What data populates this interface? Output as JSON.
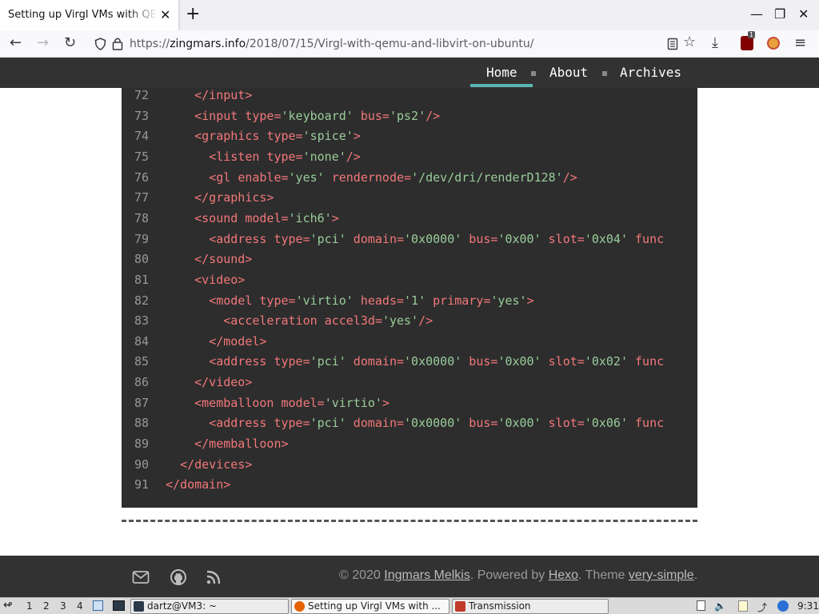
{
  "browser": {
    "tab_title": "Setting up Virgl VMs with QEMU",
    "tab_close": "✕",
    "new_tab": "+",
    "url_scheme": "https://",
    "url_host": "zingmars.info",
    "url_path": "/2018/07/15/Virgl-with-qemu-and-libvirt-on-ubuntu/",
    "extension_badge": "1"
  },
  "site": {
    "menu": [
      "Home",
      "About",
      "Archives"
    ]
  },
  "code": {
    "lines": [
      {
        "n": "72",
        "indent": "    ",
        "parts": [
          [
            "tag",
            "</input>"
          ]
        ]
      },
      {
        "n": "73",
        "indent": "    ",
        "parts": [
          [
            "tag",
            "<input "
          ],
          [
            "attr",
            "type="
          ],
          [
            "val",
            "'keyboard'"
          ],
          [
            "attr",
            " bus="
          ],
          [
            "val",
            "'ps2'"
          ],
          [
            "tag",
            "/>"
          ]
        ]
      },
      {
        "n": "74",
        "indent": "    ",
        "parts": [
          [
            "tag",
            "<graphics "
          ],
          [
            "attr",
            "type="
          ],
          [
            "val",
            "'spice'"
          ],
          [
            "tag",
            ">"
          ]
        ]
      },
      {
        "n": "75",
        "indent": "      ",
        "parts": [
          [
            "tag",
            "<listen "
          ],
          [
            "attr",
            "type="
          ],
          [
            "val",
            "'none'"
          ],
          [
            "tag",
            "/>"
          ]
        ]
      },
      {
        "n": "76",
        "indent": "      ",
        "parts": [
          [
            "tag",
            "<gl "
          ],
          [
            "attr",
            "enable="
          ],
          [
            "val",
            "'yes'"
          ],
          [
            "attr",
            " rendernode="
          ],
          [
            "val",
            "'/dev/dri/renderD128'"
          ],
          [
            "tag",
            "/>"
          ]
        ]
      },
      {
        "n": "77",
        "indent": "    ",
        "parts": [
          [
            "tag",
            "</graphics>"
          ]
        ]
      },
      {
        "n": "78",
        "indent": "    ",
        "parts": [
          [
            "tag",
            "<sound "
          ],
          [
            "attr",
            "model="
          ],
          [
            "val",
            "'ich6'"
          ],
          [
            "tag",
            ">"
          ]
        ]
      },
      {
        "n": "79",
        "indent": "      ",
        "parts": [
          [
            "tag",
            "<address "
          ],
          [
            "attr",
            "type="
          ],
          [
            "val",
            "'pci'"
          ],
          [
            "attr",
            " domain="
          ],
          [
            "val",
            "'0x0000'"
          ],
          [
            "attr",
            " bus="
          ],
          [
            "val",
            "'0x00'"
          ],
          [
            "attr",
            " slot="
          ],
          [
            "val",
            "'0x04'"
          ],
          [
            "attr",
            " func"
          ]
        ]
      },
      {
        "n": "80",
        "indent": "    ",
        "parts": [
          [
            "tag",
            "</sound>"
          ]
        ]
      },
      {
        "n": "81",
        "indent": "    ",
        "parts": [
          [
            "tag",
            "<video>"
          ]
        ]
      },
      {
        "n": "82",
        "indent": "      ",
        "parts": [
          [
            "tag",
            "<model "
          ],
          [
            "attr",
            "type="
          ],
          [
            "val",
            "'virtio'"
          ],
          [
            "attr",
            " heads="
          ],
          [
            "val",
            "'1'"
          ],
          [
            "attr",
            " primary="
          ],
          [
            "val",
            "'yes'"
          ],
          [
            "tag",
            ">"
          ]
        ]
      },
      {
        "n": "83",
        "indent": "        ",
        "parts": [
          [
            "tag",
            "<acceleration "
          ],
          [
            "attr",
            "accel3d="
          ],
          [
            "val",
            "'yes'"
          ],
          [
            "tag",
            "/>"
          ]
        ]
      },
      {
        "n": "84",
        "indent": "      ",
        "parts": [
          [
            "tag",
            "</model>"
          ]
        ]
      },
      {
        "n": "85",
        "indent": "      ",
        "parts": [
          [
            "tag",
            "<address "
          ],
          [
            "attr",
            "type="
          ],
          [
            "val",
            "'pci'"
          ],
          [
            "attr",
            " domain="
          ],
          [
            "val",
            "'0x0000'"
          ],
          [
            "attr",
            " bus="
          ],
          [
            "val",
            "'0x00'"
          ],
          [
            "attr",
            " slot="
          ],
          [
            "val",
            "'0x02'"
          ],
          [
            "attr",
            " func"
          ]
        ]
      },
      {
        "n": "86",
        "indent": "    ",
        "parts": [
          [
            "tag",
            "</video>"
          ]
        ]
      },
      {
        "n": "87",
        "indent": "    ",
        "parts": [
          [
            "tag",
            "<memballoon "
          ],
          [
            "attr",
            "model="
          ],
          [
            "val",
            "'virtio'"
          ],
          [
            "tag",
            ">"
          ]
        ]
      },
      {
        "n": "88",
        "indent": "      ",
        "parts": [
          [
            "tag",
            "<address "
          ],
          [
            "attr",
            "type="
          ],
          [
            "val",
            "'pci'"
          ],
          [
            "attr",
            " domain="
          ],
          [
            "val",
            "'0x0000'"
          ],
          [
            "attr",
            " bus="
          ],
          [
            "val",
            "'0x00'"
          ],
          [
            "attr",
            " slot="
          ],
          [
            "val",
            "'0x06'"
          ],
          [
            "attr",
            " func"
          ]
        ]
      },
      {
        "n": "89",
        "indent": "    ",
        "parts": [
          [
            "tag",
            "</memballoon>"
          ]
        ]
      },
      {
        "n": "90",
        "indent": "  ",
        "parts": [
          [
            "tag",
            "</devices>"
          ]
        ]
      },
      {
        "n": "91",
        "indent": "",
        "parts": [
          [
            "tag",
            "</domain>"
          ]
        ]
      }
    ]
  },
  "footer": {
    "copyright": "© 2020 ",
    "author": "Ingmars Melkis",
    "powered": ". Powered by ",
    "hexo": "Hexo",
    "theme": ". Theme ",
    "theme_name": "very-simple",
    "end": "."
  },
  "taskbar": {
    "workspaces": [
      "1",
      "2",
      "3",
      "4"
    ],
    "tasks": [
      "dartz@VM3: ~",
      "Setting up Virgl VMs with ...",
      "Transmission"
    ],
    "clock": "9:31"
  }
}
